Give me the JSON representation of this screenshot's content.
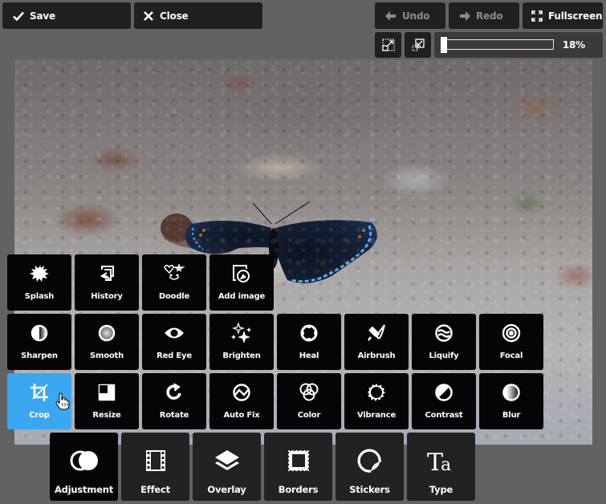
{
  "toolbar": {
    "save": {
      "label": "Save",
      "icon": "checkmark-icon"
    },
    "close": {
      "label": "Close",
      "icon": "x-icon"
    },
    "undo": {
      "label": "Undo",
      "icon": "arrow-left-icon",
      "enabled": false
    },
    "redo": {
      "label": "Redo",
      "icon": "arrow-right-icon",
      "enabled": false
    },
    "fullscreen": {
      "label": "Fullscreen",
      "icon": "fullscreen-icon"
    },
    "fit_to_screen": {
      "icon": "fit-to-screen-icon"
    },
    "actual_size": {
      "icon": "actual-size-icon"
    },
    "zoom": {
      "value_percent": 18,
      "label": "18%"
    }
  },
  "canvas": {
    "subject": "photo of a dark blue butterfly on gravel ground"
  },
  "tool_panel": {
    "rows": [
      [
        {
          "id": "splash",
          "label": "Splash",
          "icon": "splash-icon"
        },
        {
          "id": "history",
          "label": "History",
          "icon": "history-icon"
        },
        {
          "id": "doodle",
          "label": "Doodle",
          "icon": "doodle-icon"
        },
        {
          "id": "add-image",
          "label": "Add image",
          "icon": "add-image-icon"
        }
      ],
      [
        {
          "id": "sharpen",
          "label": "Sharpen",
          "icon": "sharpen-icon"
        },
        {
          "id": "smooth",
          "label": "Smooth",
          "icon": "smooth-icon"
        },
        {
          "id": "red-eye",
          "label": "Red Eye",
          "icon": "eye-icon"
        },
        {
          "id": "brighten",
          "label": "Brighten",
          "icon": "sparkles-icon"
        },
        {
          "id": "heal",
          "label": "Heal",
          "icon": "heal-icon"
        },
        {
          "id": "airbrush",
          "label": "Airbrush",
          "icon": "airbrush-icon"
        },
        {
          "id": "liquify",
          "label": "Liquify",
          "icon": "liquify-icon"
        },
        {
          "id": "focal",
          "label": "Focal",
          "icon": "target-icon"
        }
      ],
      [
        {
          "id": "crop",
          "label": "Crop",
          "icon": "crop-icon",
          "active": true
        },
        {
          "id": "resize",
          "label": "Resize",
          "icon": "resize-icon"
        },
        {
          "id": "rotate",
          "label": "Rotate",
          "icon": "rotate-icon"
        },
        {
          "id": "auto-fix",
          "label": "Auto Fix",
          "icon": "auto-fix-icon"
        },
        {
          "id": "color",
          "label": "Color",
          "icon": "color-circles-icon"
        },
        {
          "id": "vibrance",
          "label": "Vibrance",
          "icon": "vibrance-icon"
        },
        {
          "id": "contrast",
          "label": "Contrast",
          "icon": "contrast-icon"
        },
        {
          "id": "blur",
          "label": "Blur",
          "icon": "blur-icon"
        }
      ]
    ]
  },
  "categories": [
    {
      "id": "adjustment",
      "label": "Adjustment",
      "icon": "adjustment-icon",
      "active": true
    },
    {
      "id": "effect",
      "label": "Effect",
      "icon": "film-icon"
    },
    {
      "id": "overlay",
      "label": "Overlay",
      "icon": "layers-icon"
    },
    {
      "id": "borders",
      "label": "Borders",
      "icon": "stamp-border-icon"
    },
    {
      "id": "stickers",
      "label": "Stickers",
      "icon": "sticker-icon"
    },
    {
      "id": "type",
      "label": "Type",
      "icon": "type-icon"
    }
  ],
  "colors": {
    "background": "#626262",
    "button": "#202020",
    "tile": "#050505",
    "active_tile": "#3ba7f0",
    "category": "#222222",
    "disabled_text": "#8c8c8c"
  }
}
